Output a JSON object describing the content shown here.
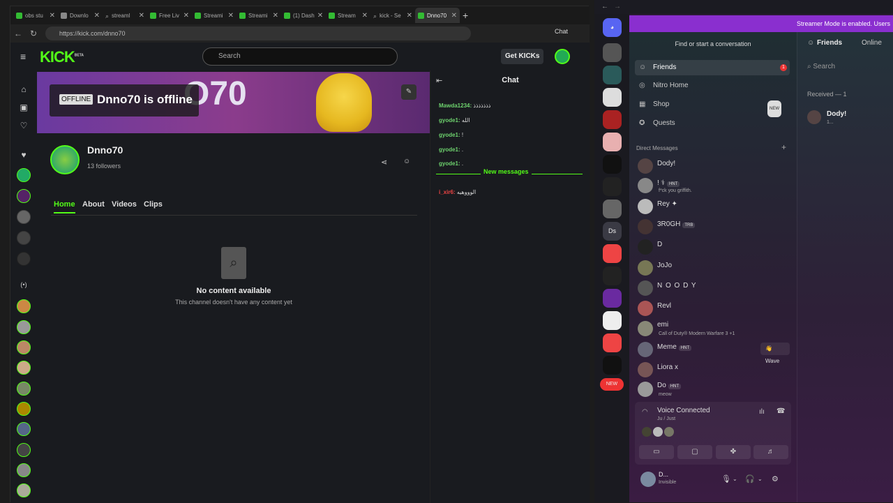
{
  "browser": {
    "tabs": [
      {
        "label": "obs stu"
      },
      {
        "label": "Downlo"
      },
      {
        "label": "streaml"
      },
      {
        "label": "Free Liv"
      },
      {
        "label": "Streami"
      },
      {
        "label": "Streami"
      },
      {
        "label": "(1) Dash"
      },
      {
        "label": "Stream"
      },
      {
        "label": "kick - Se"
      },
      {
        "label": "Dnno70"
      }
    ],
    "url": "https://kick.com/dnno70",
    "chat_label": "Chat"
  },
  "kick": {
    "logo": "KICK",
    "beta": "BETA",
    "search_placeholder": "Search",
    "get_kicks": "Get KICKs",
    "offline_badge": "OFFLINE",
    "offline_title": "Dnno70 is offline",
    "banner_text": "O70",
    "channel_name": "Dnno70",
    "followers": "13 followers",
    "tabs": [
      "Home",
      "About",
      "Videos",
      "Clips"
    ],
    "no_content_title": "No content available",
    "no_content_sub": "This channel doesn't have any content yet"
  },
  "chat": {
    "title": "Chat",
    "messages": [
      {
        "user": "Mawda1234:",
        "text": "ذذذذذذذ"
      },
      {
        "user": "gyode1:",
        "text": "الله"
      },
      {
        "user": "gyode1:",
        "text": "!"
      },
      {
        "user": "gyode1:",
        "text": "."
      },
      {
        "user": "gyode1:",
        "text": "."
      }
    ],
    "new_messages": "New messages",
    "new_message": {
      "user": "i_xir6:",
      "text": "الوووهيه"
    }
  },
  "discord": {
    "streamer_banner": "Streamer Mode is enabled. Users",
    "find_conversation": "Find or start a conversation",
    "nav": [
      {
        "label": "Friends",
        "icon": "friends-icon"
      },
      {
        "label": "Nitro Home",
        "icon": "nitro-icon"
      },
      {
        "label": "Shop",
        "icon": "shop-icon"
      },
      {
        "label": "Quests",
        "icon": "quests-icon"
      }
    ],
    "friends_pill": "1",
    "shop_badge": "NEW",
    "dm_header": "Direct Messages",
    "dms": [
      {
        "name": "Dody!",
        "sub": "",
        "tag": ""
      },
      {
        "name": "! ⚕",
        "sub": "f*ck you griffith.",
        "tag": "HNT"
      },
      {
        "name": "Rey ✦",
        "sub": "",
        "tag": ""
      },
      {
        "name": "3R0GH",
        "sub": "",
        "tag": "TRB"
      },
      {
        "name": "D",
        "sub": "",
        "tag": ""
      },
      {
        "name": "JoJo",
        "sub": "",
        "tag": ""
      },
      {
        "name": "N O O D Y",
        "sub": "",
        "tag": ""
      },
      {
        "name": "Revl",
        "sub": "",
        "tag": ""
      },
      {
        "name": "emi",
        "sub": "Call of Duty® Modern Warfare 3 +1",
        "tag": ""
      },
      {
        "name": "Meme",
        "sub": "",
        "tag": "HNT"
      },
      {
        "name": "Liora x",
        "sub": "",
        "tag": ""
      },
      {
        "name": "Do",
        "sub": "meow",
        "tag": "HNT"
      }
    ],
    "wave": "👋 Wave",
    "voice_title": "Voice Connected",
    "voice_sub": "Ju / Just",
    "user_name": "D...",
    "user_status": "Invisible",
    "servers": [
      "Ds",
      "NEW"
    ],
    "friends_header": "Friends",
    "online_tab": "Online",
    "friends_search": "Search",
    "received": "Received — 1",
    "friend_request": {
      "name": "Dody!",
      "sub": "1..."
    }
  }
}
